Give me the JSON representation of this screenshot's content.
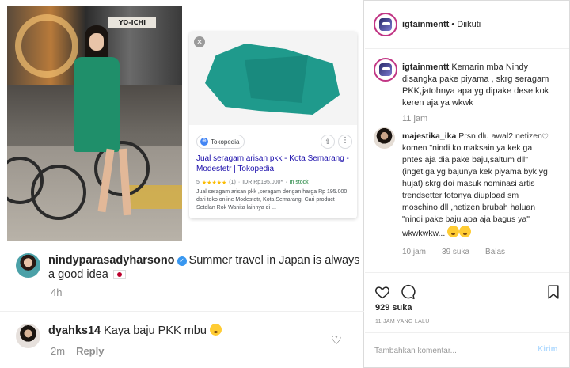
{
  "left_panel": {
    "product_card": {
      "source": "Tokopedia",
      "title": "Jual seragam arisan pkk - Kota Semarang - Modestetr | Tokopedia",
      "rating": "5",
      "stars": "★★★★★",
      "reviews": "(1)",
      "price": "IDR Rp195,000*",
      "stock": "In stock",
      "description": "Jual seragam arisan pkk ,seragam dengan harga Rp 195.000 dari toko online Modestetr, Kota Semarang. Cari product Setelan Rok Wanita lainnya di ..."
    },
    "photo": {
      "sign_text": "YO-ICHI"
    },
    "caption": {
      "username": "nindyparasadyharsono",
      "text": "Summer travel in Japan is always a good idea",
      "time": "4h"
    },
    "comment": {
      "username": "dyahks14",
      "text": "Kaya baju PKK mbu",
      "time": "2m",
      "reply_label": "Reply"
    }
  },
  "right_panel": {
    "header": {
      "username": "igtainmentt",
      "separator": " • ",
      "follow_label": "Diikuti"
    },
    "caption": {
      "username": "igtainmentt",
      "text": "Kemarin mba Nindy disangka pake piyama , skrg seragam PKK,jatohnya apa yg dipake dese kok keren aja ya wkwk",
      "time": "11 jam"
    },
    "comment": {
      "username": "majestika_ika",
      "text": "Prsn dlu awal2 netizen komen \"nindi ko maksain ya kek ga pntes aja dia pake baju,saltum dll\" (inget ga yg bajunya kek piyama byk yg hujat) skrg doi masuk nominasi artis trendsetter fotonya diupload sm moschino dll ,netizen brubah haluan \"nindi pake baju apa aja bagus ya\" wkwkwkw...",
      "time": "10 jam",
      "likes": "39 suka",
      "reply_label": "Balas"
    },
    "likes": "929 suka",
    "posted": "11 JAM YANG LALU",
    "input": {
      "placeholder": "Tambahkan komentar...",
      "submit_label": "Kirim"
    },
    "colors": {
      "link_blue": "#b3dbff",
      "verified": "#3897f0"
    }
  }
}
